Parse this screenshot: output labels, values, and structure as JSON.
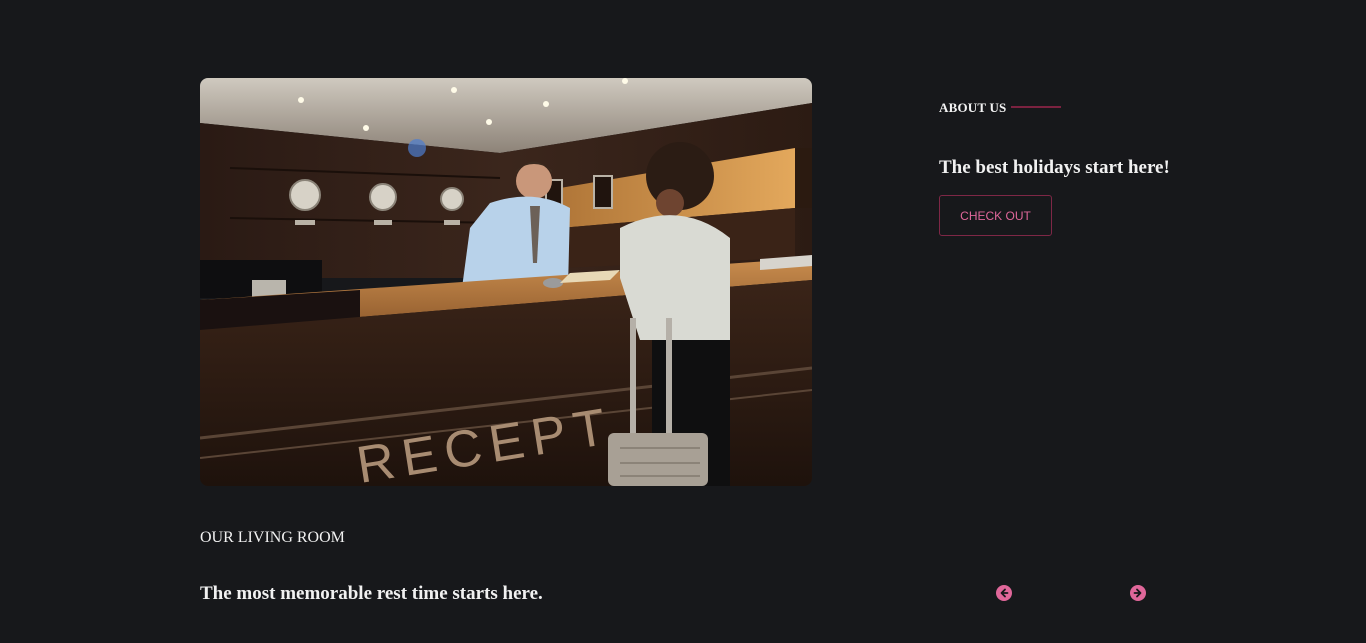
{
  "hero": {
    "image_alt": "Hotel reception desk with receptionist and guest with suitcase",
    "desk_sign": "RECEPT"
  },
  "about": {
    "eyebrow": "ABOUT US",
    "title": "The best holidays start here!",
    "cta_label": "CHECK OUT"
  },
  "living": {
    "eyebrow": "OUR LIVING ROOM",
    "title": "The most memorable rest time starts here."
  },
  "carousel": {
    "prev_icon": "arrow-left-circle-icon",
    "next_icon": "arrow-right-circle-icon"
  },
  "colors": {
    "background": "#17181b",
    "accent": "#e0679a",
    "accent_dark": "#7e2746",
    "text": "#f1f1f1"
  }
}
